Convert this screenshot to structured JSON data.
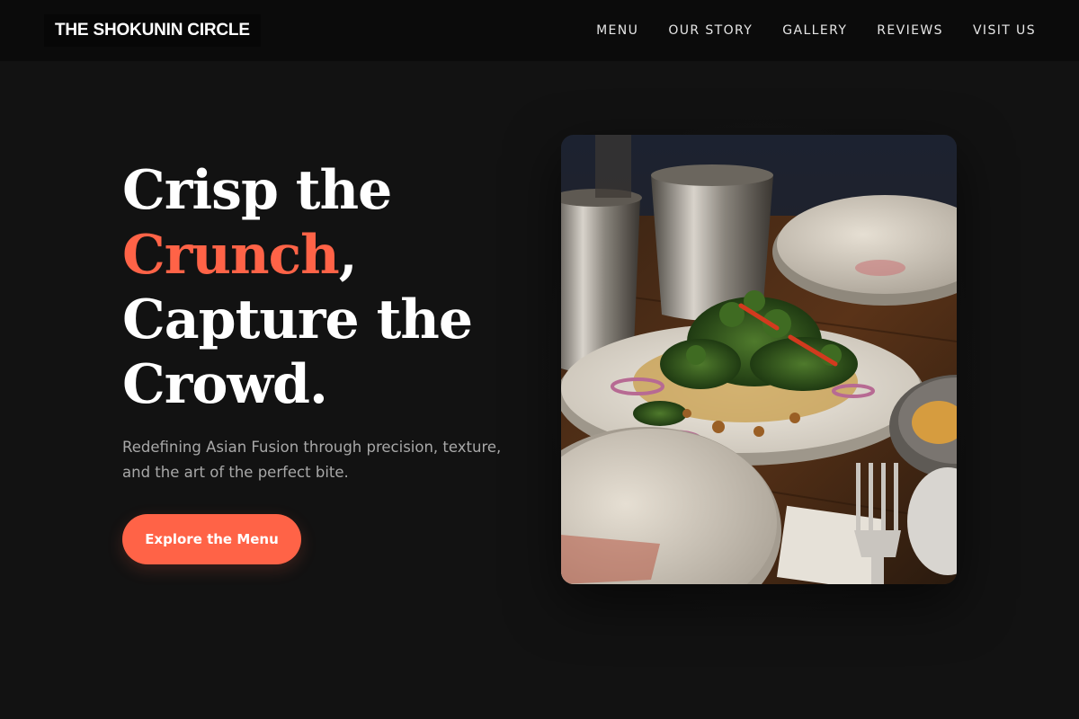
{
  "brand": {
    "name": "THE SHOKUNIN CIRCLE"
  },
  "nav": {
    "items": [
      {
        "label": "MENU"
      },
      {
        "label": "OUR STORY"
      },
      {
        "label": "GALLERY"
      },
      {
        "label": "REVIEWS"
      },
      {
        "label": "VISIT US"
      }
    ]
  },
  "hero": {
    "headline": {
      "line1": "Crisp the",
      "accent_word": "Crunch",
      "accent_suffix": ",",
      "line3": "Capture the",
      "line4": "Crowd."
    },
    "subtitle": "Redefining Asian Fusion through precision, texture, and the art of the perfect bite.",
    "cta_label": "Explore the Menu",
    "image_alt_icon": "salad-dish-photo"
  },
  "colors": {
    "background": "#121212",
    "topbar": "#0b0b0b",
    "accent": "#ff6347",
    "text": "#ffffff",
    "muted_text": "#a8a8a8"
  }
}
